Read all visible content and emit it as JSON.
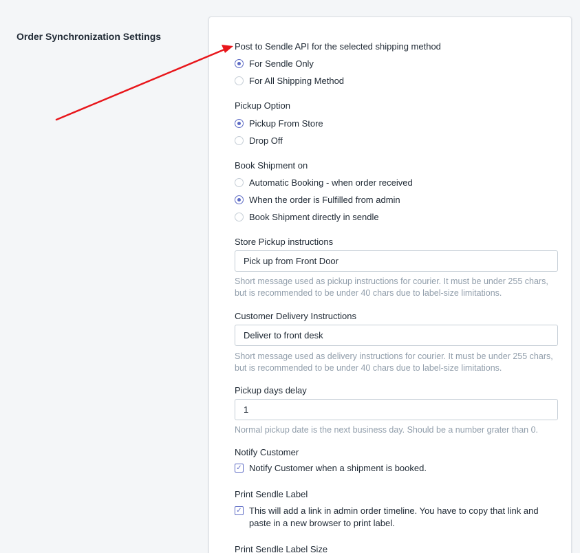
{
  "section": {
    "title": "Order Synchronization Settings"
  },
  "post_api": {
    "label": "Post to Sendle API for the selected shipping method",
    "options": [
      "For Sendle Only",
      "For All Shipping Method"
    ],
    "selected": "For Sendle Only"
  },
  "pickup_option": {
    "label": "Pickup Option",
    "options": [
      "Pickup From Store",
      "Drop Off"
    ],
    "selected": "Pickup From Store"
  },
  "book_shipment": {
    "label": "Book Shipment on",
    "options": [
      "Automatic Booking - when order received",
      "When the order is Fulfilled from admin",
      "Book Shipment directly in sendle"
    ],
    "selected": "When the order is Fulfilled from admin"
  },
  "store_pickup": {
    "label": "Store Pickup instructions",
    "value": "Pick up from Front Door",
    "help": "Short message used as pickup instructions for courier. It must be under 255 chars, but is recommended to be under 40 chars due to label-size limitations."
  },
  "customer_delivery": {
    "label": "Customer Delivery Instructions",
    "value": "Deliver to front desk",
    "help": "Short message used as delivery instructions for courier. It must be under 255 chars, but is recommended to be under 40 chars due to label-size limitations."
  },
  "pickup_delay": {
    "label": "Pickup days delay",
    "value": "1",
    "help": "Normal pickup date is the next business day. Should be a number grater than 0."
  },
  "notify_customer": {
    "label": "Notify Customer",
    "checkbox_label": "Notify Customer when a shipment is booked.",
    "checked": true
  },
  "print_label": {
    "label": "Print Sendle Label",
    "checkbox_label": "This will add a link in admin order timeline. You have to copy that link and paste in a new browser to print label.",
    "checked": true
  },
  "print_label_size": {
    "label": "Print Sendle Label Size"
  },
  "colors": {
    "accent": "#5c6ac4",
    "annotation_arrow": "#e8161b"
  }
}
